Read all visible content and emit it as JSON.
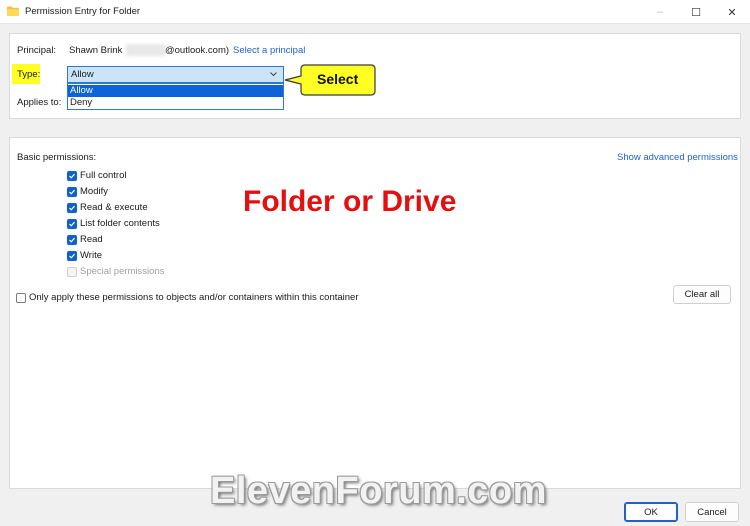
{
  "window": {
    "title": "Permission Entry for Folder",
    "controls": {
      "minimize": "–",
      "maximize": "☐",
      "close": "✕"
    }
  },
  "principal": {
    "label": "Principal:",
    "name": "Shawn Brink",
    "email_visible": "@outlook.com)",
    "select_link": "Select a principal"
  },
  "type": {
    "label": "Type:",
    "value": "Allow",
    "options": [
      "Allow",
      "Deny"
    ],
    "selected_option": "Allow",
    "highlight_color": "#ffff24"
  },
  "applies_to": {
    "label": "Applies to:"
  },
  "callout": {
    "text": "Select",
    "fill": "#ffff24"
  },
  "basic_permissions": {
    "label": "Basic permissions:",
    "show_advanced_link": "Show advanced permissions",
    "items": [
      {
        "label": "Full control",
        "checked": true,
        "enabled": true
      },
      {
        "label": "Modify",
        "checked": true,
        "enabled": true
      },
      {
        "label": "Read & execute",
        "checked": true,
        "enabled": true
      },
      {
        "label": "List folder contents",
        "checked": true,
        "enabled": true
      },
      {
        "label": "Read",
        "checked": true,
        "enabled": true
      },
      {
        "label": "Write",
        "checked": true,
        "enabled": true
      },
      {
        "label": "Special permissions",
        "checked": false,
        "enabled": false
      }
    ]
  },
  "only_apply": {
    "label": "Only apply these permissions to objects and/or containers within this container",
    "checked": false
  },
  "overlay_text": "Folder or Drive",
  "buttons": {
    "clear_all": "Clear all",
    "ok": "OK",
    "cancel": "Cancel"
  },
  "watermark": "ElevenForum.com",
  "colors": {
    "accent": "#0f62c9",
    "link": "#1f62c7",
    "overlay": "#e41010"
  }
}
